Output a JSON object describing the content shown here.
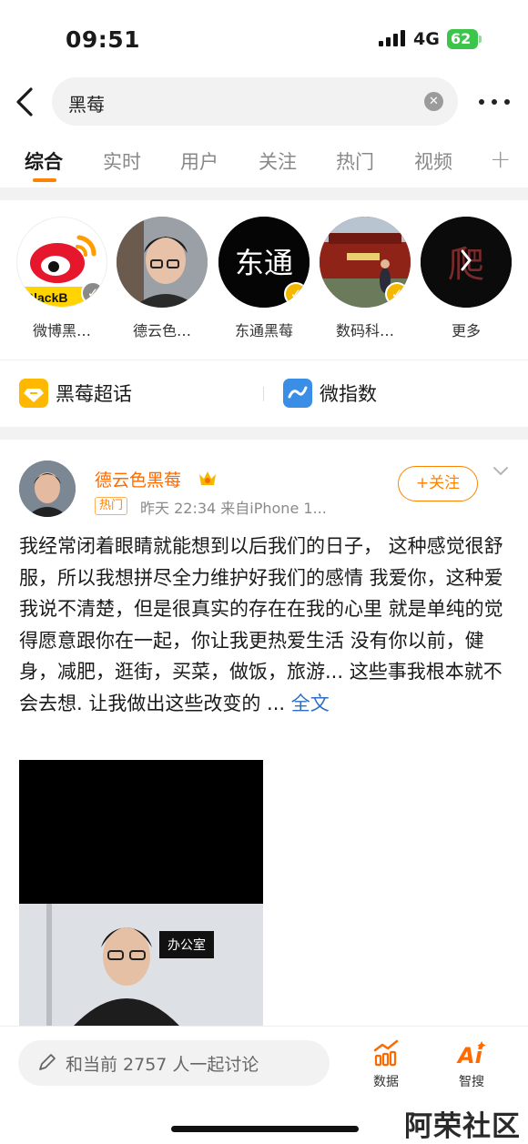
{
  "status": {
    "time": "09:51",
    "network": "4G",
    "battery": "62"
  },
  "search": {
    "query": "黑莓"
  },
  "tabs": [
    "综合",
    "实时",
    "用户",
    "关注",
    "热门",
    "视频"
  ],
  "users": [
    {
      "name": "微博黑…",
      "avatar_text": "BlackB"
    },
    {
      "name": "德云色…"
    },
    {
      "name": "东通黑莓",
      "avatar_text": "东通"
    },
    {
      "name": "数码科…"
    },
    {
      "name": "更多",
      "avatar_text": "爬"
    }
  ],
  "topics": {
    "super_topic": "黑莓超话",
    "index": "微指数"
  },
  "post": {
    "author": "德云色黑莓",
    "badge": "热门",
    "meta": "昨天 22:34  来自iPhone 1...",
    "follow": "+关注",
    "text": "我经常闭着眼睛就能想到以后我们的日子， 这种感觉很舒服，所以我想拼尽全力维护好我们的感情 我爱你，这种爱我说不清楚，但是很真实的存在在我的心里 就是单纯的觉得愿意跟你在一起，你让我更热爱生活 没有你以前，健身，减肥，逛街，买菜，做饭，旅游... 这些事我根本就不会去想. 让我做出这些改变的 ... ",
    "fulltext": "全文",
    "video_sign": "办公室"
  },
  "bottom": {
    "discuss": "和当前 2757 人一起讨论",
    "data": "数据",
    "ai": "智搜",
    "ai_icon": "Ai"
  },
  "watermark": "阿荣社区",
  "colors": {
    "accent": "#ff8200",
    "link": "#2f6fc3",
    "verify_gold": "#f5b800"
  }
}
